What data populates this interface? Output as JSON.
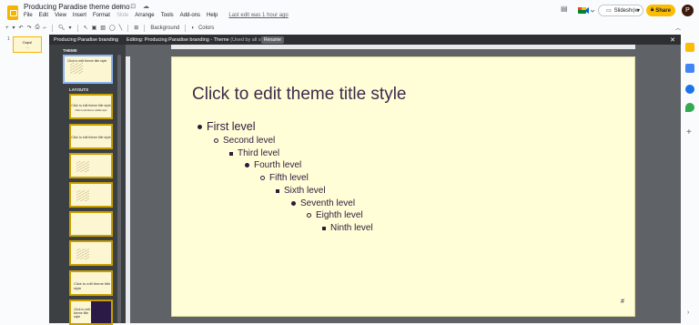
{
  "header": {
    "doc_title": "Producing Paradise theme demo",
    "title_icons": "☆ ⊡ ☁",
    "menus": [
      "File",
      "Edit",
      "View",
      "Insert",
      "Format",
      "Slide",
      "Arrange",
      "Tools",
      "Add-ons",
      "Help"
    ],
    "disabled_menu": "Slide",
    "last_edit": "Last edit was 1 hour ago",
    "slideshow_label": "Slideshow",
    "share_label": "Share",
    "avatar_initial": "P"
  },
  "toolbar": {
    "background_label": "Background",
    "colors_label": "Colors"
  },
  "filmstrip": {
    "slide_number": "1",
    "thumb_title": "Oops!",
    "thumb_sub": "..."
  },
  "theme_panel": {
    "header_left": "Producing Paradise branding",
    "editing_title": "Editing: Producing Paradise branding - Theme",
    "editing_sub": "(Used by all slides)",
    "rename_label": "Rename",
    "theme_label": "THEME",
    "layouts_label": "LAYOUTS",
    "theme_thumb_text": "Click to edit theme title style",
    "layouts": [
      {
        "text": "Click to edit theme title style",
        "sub": "Click to edit theme subtitle style"
      },
      {
        "text": "Click to edit theme title style",
        "sub": ""
      },
      {
        "text": "",
        "sub": ""
      },
      {
        "text": "",
        "sub": ""
      },
      {
        "text": "",
        "sub": ""
      },
      {
        "text": "",
        "sub": ""
      },
      {
        "text": "Click to edit theme title style",
        "sub": ""
      },
      {
        "text": "Click to edit theme title style",
        "sub": ""
      }
    ]
  },
  "slide": {
    "title": "Click to edit theme title style",
    "levels": [
      "First level",
      "Second level",
      "Third level",
      "Fourth level",
      "Fifth level",
      "Sixth level",
      "Seventh level",
      "Eighth level",
      "Ninth level"
    ],
    "slide_number_placeholder": "#"
  },
  "colors": {
    "accent": "#fbbc04",
    "slide_bg": "#fffed6",
    "text": "#3c2a4d"
  }
}
